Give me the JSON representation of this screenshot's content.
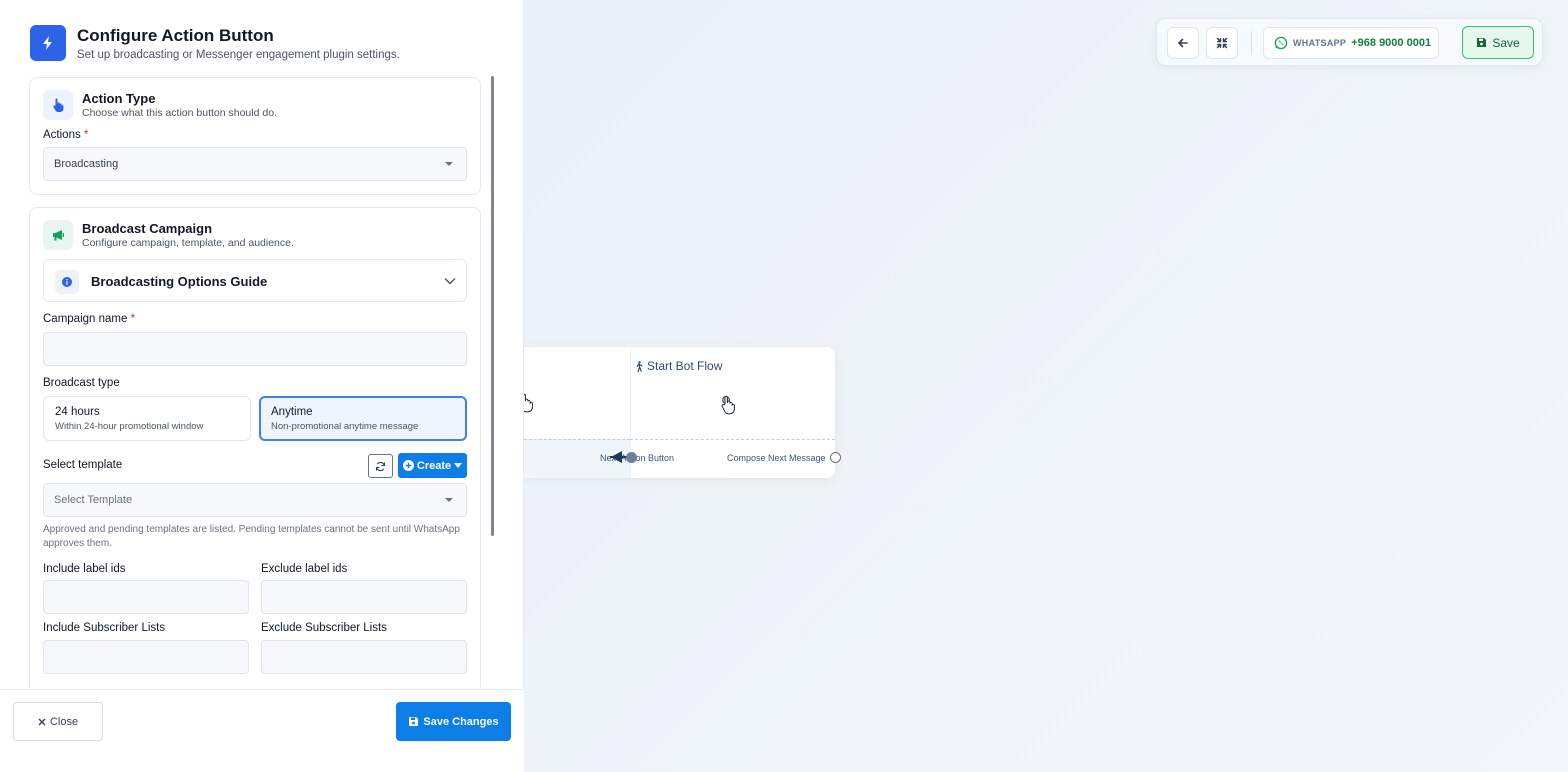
{
  "panel": {
    "title": "Configure Action Button",
    "subtitle": "Set up broadcasting or Messenger engagement plugin settings.",
    "header_icon": "bolt-icon",
    "action_type": {
      "title": "Action Type",
      "subtitle": "Choose what this action button should do.",
      "icon": "hand-pointer-icon",
      "actions_label": "Actions",
      "required_mark": "*",
      "actions_value": "Broadcasting"
    },
    "broadcast": {
      "title": "Broadcast Campaign",
      "subtitle": "Configure campaign, template, and audience.",
      "icon": "megaphone-icon",
      "guide_title": "Broadcasting Options Guide",
      "campaign_label": "Campaign name",
      "campaign_value": "",
      "type_label": "Broadcast type",
      "types": [
        {
          "title": "24 hours",
          "desc": "Within 24-hour promotional window",
          "selected": false
        },
        {
          "title": "Anytime",
          "desc": "Non-promotional anytime message",
          "selected": true
        }
      ],
      "template_label": "Select template",
      "create_label": "Create",
      "template_placeholder": "Select Template",
      "help_text": "Approved and pending templates are listed. Pending templates cannot be sent until WhatsApp approves them.",
      "include_labels": "Include label ids",
      "exclude_labels": "Exclude label ids",
      "include_lists": "Include Subscriber Lists",
      "exclude_lists": "Exclude Subscriber Lists"
    },
    "footer": {
      "close_label": "Close",
      "save_label": "Save Changes"
    }
  },
  "toolbar": {
    "whatsapp_label": "WHATSAPP",
    "whatsapp_number": "+968 9000 0001",
    "save_label": "Save"
  },
  "node": {
    "title": "Start Bot Flow",
    "next_action_label": "Next Action Button",
    "compose_label": "Compose Next Message"
  },
  "colors": {
    "primary": "#0d7ee8",
    "header_icon_bg": "#2d63e6",
    "whatsapp_green": "#15803d",
    "required": "#dc2626"
  }
}
